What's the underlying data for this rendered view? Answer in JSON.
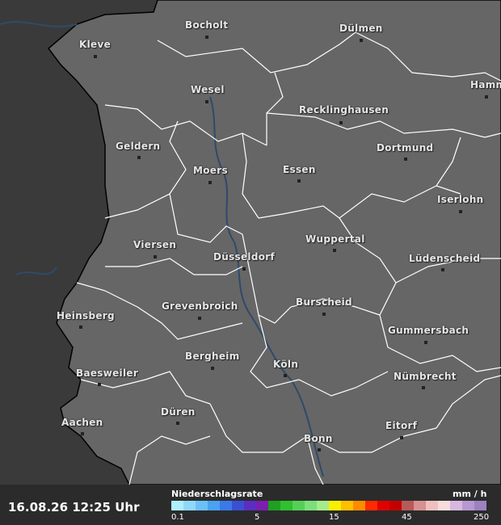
{
  "cities": [
    {
      "name": "Bocholt"
    },
    {
      "name": "Dülmen"
    },
    {
      "name": "Kleve"
    },
    {
      "name": "Hamm"
    },
    {
      "name": "Wesel"
    },
    {
      "name": "Recklinghausen"
    },
    {
      "name": "Geldern"
    },
    {
      "name": "Dortmund"
    },
    {
      "name": "Moers"
    },
    {
      "name": "Essen"
    },
    {
      "name": "Iserlohn"
    },
    {
      "name": "Viersen"
    },
    {
      "name": "Wuppertal"
    },
    {
      "name": "Düsseldorf"
    },
    {
      "name": "Lüdenscheid"
    },
    {
      "name": "Heinsberg"
    },
    {
      "name": "Grevenbroich"
    },
    {
      "name": "Burscheid"
    },
    {
      "name": "Gummersbach"
    },
    {
      "name": "Bergheim"
    },
    {
      "name": "Baesweiler"
    },
    {
      "name": "Köln"
    },
    {
      "name": "Nümbrecht"
    },
    {
      "name": "Aachen"
    },
    {
      "name": "Düren"
    },
    {
      "name": "Eitorf"
    },
    {
      "name": "Bonn"
    }
  ],
  "timestamp": "16.08.26 12:25 Uhr",
  "legend": {
    "title": "Niederschlagsrate",
    "unit": "mm / h",
    "ticks": [
      "0.1",
      "5",
      "15",
      "45",
      "250"
    ],
    "colors": [
      "#aef0fb",
      "#90d8fa",
      "#6cc0fa",
      "#4aa2f2",
      "#3a7ae8",
      "#3b4fd4",
      "#5a2fc0",
      "#7a1fb0",
      "#20a020",
      "#30c030",
      "#55d055",
      "#7be07b",
      "#a6ec8a",
      "#f7f000",
      "#ffc000",
      "#ff8c00",
      "#ff2a00",
      "#e00000",
      "#c40000",
      "#b85a5a",
      "#d89090",
      "#f0c0c0",
      "#f8dcdc",
      "#d8b8e0",
      "#b898d0",
      "#9c82c0"
    ],
    "no_data_colors": [
      "#6e6e6e",
      "#888888"
    ]
  },
  "colors": {
    "land": "#666666",
    "outside": "#3a3a3a",
    "border": "#ffffff",
    "water": "#2f4a6a"
  }
}
